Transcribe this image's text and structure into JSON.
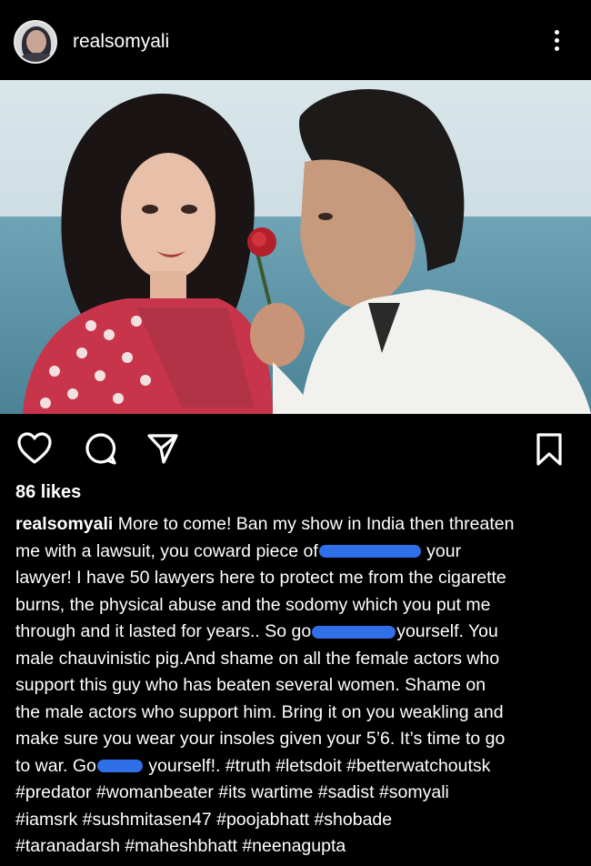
{
  "post": {
    "username": "realsomyali",
    "likes": "86 likes",
    "caption_lines": [
      {
        "user": "realsomyali",
        "text": " More to come! Ban my show in India then threaten"
      },
      {
        "pre": "me with a lawsuit, you coward piece of",
        "post": " your"
      },
      {
        "text": "lawyer! I have 50 lawyers here to protect me from the cigarette"
      },
      {
        "text": "burns, the physical abuse and the sodomy which you put me"
      },
      {
        "pre": "through and it lasted for years.. So go",
        "post": "yourself. You"
      },
      {
        "text": "male chauvinistic pig.And shame on all the female actors who"
      },
      {
        "text": "support this guy who has beaten several women. Shame on"
      },
      {
        "text": "the male actors who support him. Bring it on you weakling and"
      },
      {
        "text": "make sure you wear your insoles given your 5’6. It’s time to go"
      },
      {
        "pre": "to war. Go",
        "post": " yourself!. #truth #letsdoit #betterwatchoutsk"
      },
      {
        "text": "#predator #womanbeater #its wartime #sadist #somyali"
      },
      {
        "text": "#iamsrk #sushmitasen47 #poojabhatt #shobade"
      },
      {
        "text": "#taranadarsh #maheshbhatt #neenagupta"
      }
    ]
  },
  "icons": {
    "more": "more-options-icon",
    "like": "heart-icon",
    "comment": "comment-icon",
    "share": "send-icon",
    "save": "bookmark-icon"
  },
  "colors": {
    "background": "#000000",
    "text": "#ffffff",
    "redaction": "#2f6fe8"
  }
}
